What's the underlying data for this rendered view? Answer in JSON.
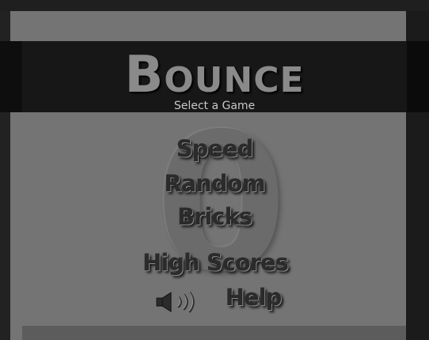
{
  "game": {
    "title_first": "B",
    "title_rest": "OUNCE",
    "subtitle": "Select a Game",
    "watermark": "0"
  },
  "menu": {
    "speed": "Speed",
    "random": "Random",
    "bricks": "Bricks",
    "high_scores": "High Scores",
    "help": "Help"
  },
  "icons": {
    "sound": "speaker-sound-on-icon"
  },
  "colors": {
    "background": "#747474",
    "header": "#171717",
    "title": "#8a8a8a",
    "menu_text": "#2b2b2b"
  }
}
